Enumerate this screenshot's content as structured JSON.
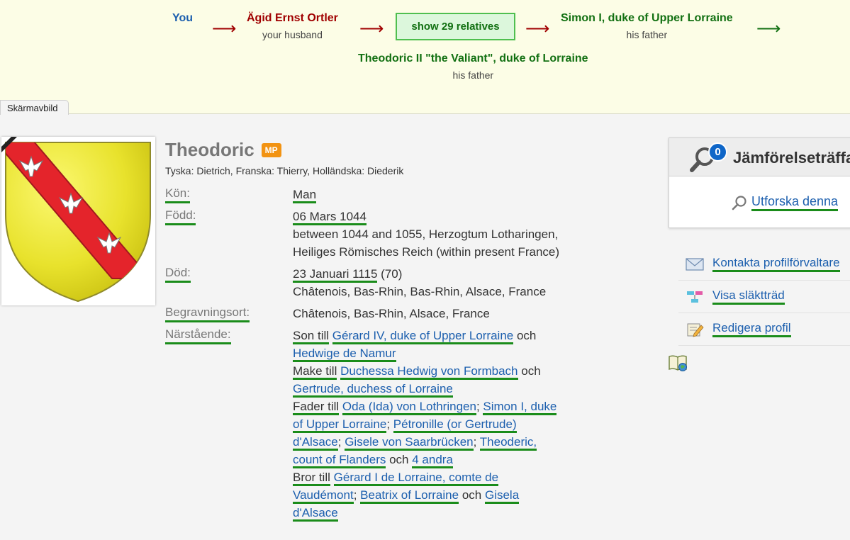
{
  "path": {
    "you": "You",
    "husband": {
      "name": "Ägid Ernst Ortler",
      "role": "your husband"
    },
    "show_relatives": "show 29 relatives",
    "simon": {
      "name": "Simon I, duke of Upper Lorraine",
      "role": "his father"
    },
    "theodoric": {
      "name": "Theodoric II \"the Valiant\", duke of Lorraine",
      "role": "his father"
    },
    "arrow": "⟶"
  },
  "tab_label": "Skärmavbild",
  "profile": {
    "name": "Theodoric",
    "badge": "MP",
    "alt_names": "Tyska: Dietrich, Franska: Thierry, Holländska: Diederik",
    "gender_label": "Kön:",
    "gender": "Man",
    "born_label": "Född:",
    "born_date": "06 Mars 1044",
    "born_place": "between 1044 and 1055, Herzogtum Lotharingen, Heiliges Römisches Reich (within present France)",
    "died_label": "Död:",
    "died_date": "23 Januari 1115",
    "died_age": " (70)",
    "died_place": "Châtenois, Bas-Rhin, Bas-Rhin, Alsace, France",
    "burial_label": "Begravningsort:",
    "burial_place": "Châtenois, Bas-Rhin, Alsace, France",
    "relatives_label": "Närstående:",
    "relatives": {
      "son_of": "Son till",
      "father1": "Gérard IV, duke of Upper Lorraine",
      "and": "och",
      "mother1": "Hedwige de Namur",
      "husband_of": "Make till",
      "wife1": "Duchessa Hedwig von Formbach",
      "wife2": "Gertrude, duchess of Lorraine",
      "father_of": "Fader till",
      "child1": "Oda (Ida) von Lothringen",
      "child2": "Simon I, duke of Upper Lorraine",
      "child3": "Pétronille (or Gertrude) d'Alsace",
      "child4": "Gisele von Saarbrücken",
      "child5": "Theoderic, count of Flanders",
      "more_children": "4 andra",
      "semicolon": ";",
      "brother_of": "Bror till",
      "sib1": "Gérard I de Lorraine, comte de Vaudémont",
      "sib2": "Beatrix of Lorraine",
      "sib3": "Gisela d'Alsace"
    }
  },
  "compare": {
    "count": "0",
    "title": "Jämförelseträffar",
    "explore": "Utforska denna"
  },
  "side_links": {
    "contact": "Kontakta profilförvaltare",
    "tree": "Visa släktträd",
    "edit": "Redigera profil"
  },
  "colors": {
    "accent_green": "#1a8c1a",
    "link_blue": "#1c5fae",
    "banner_bg": "#fcfde6",
    "badge_orange": "#f29312"
  }
}
